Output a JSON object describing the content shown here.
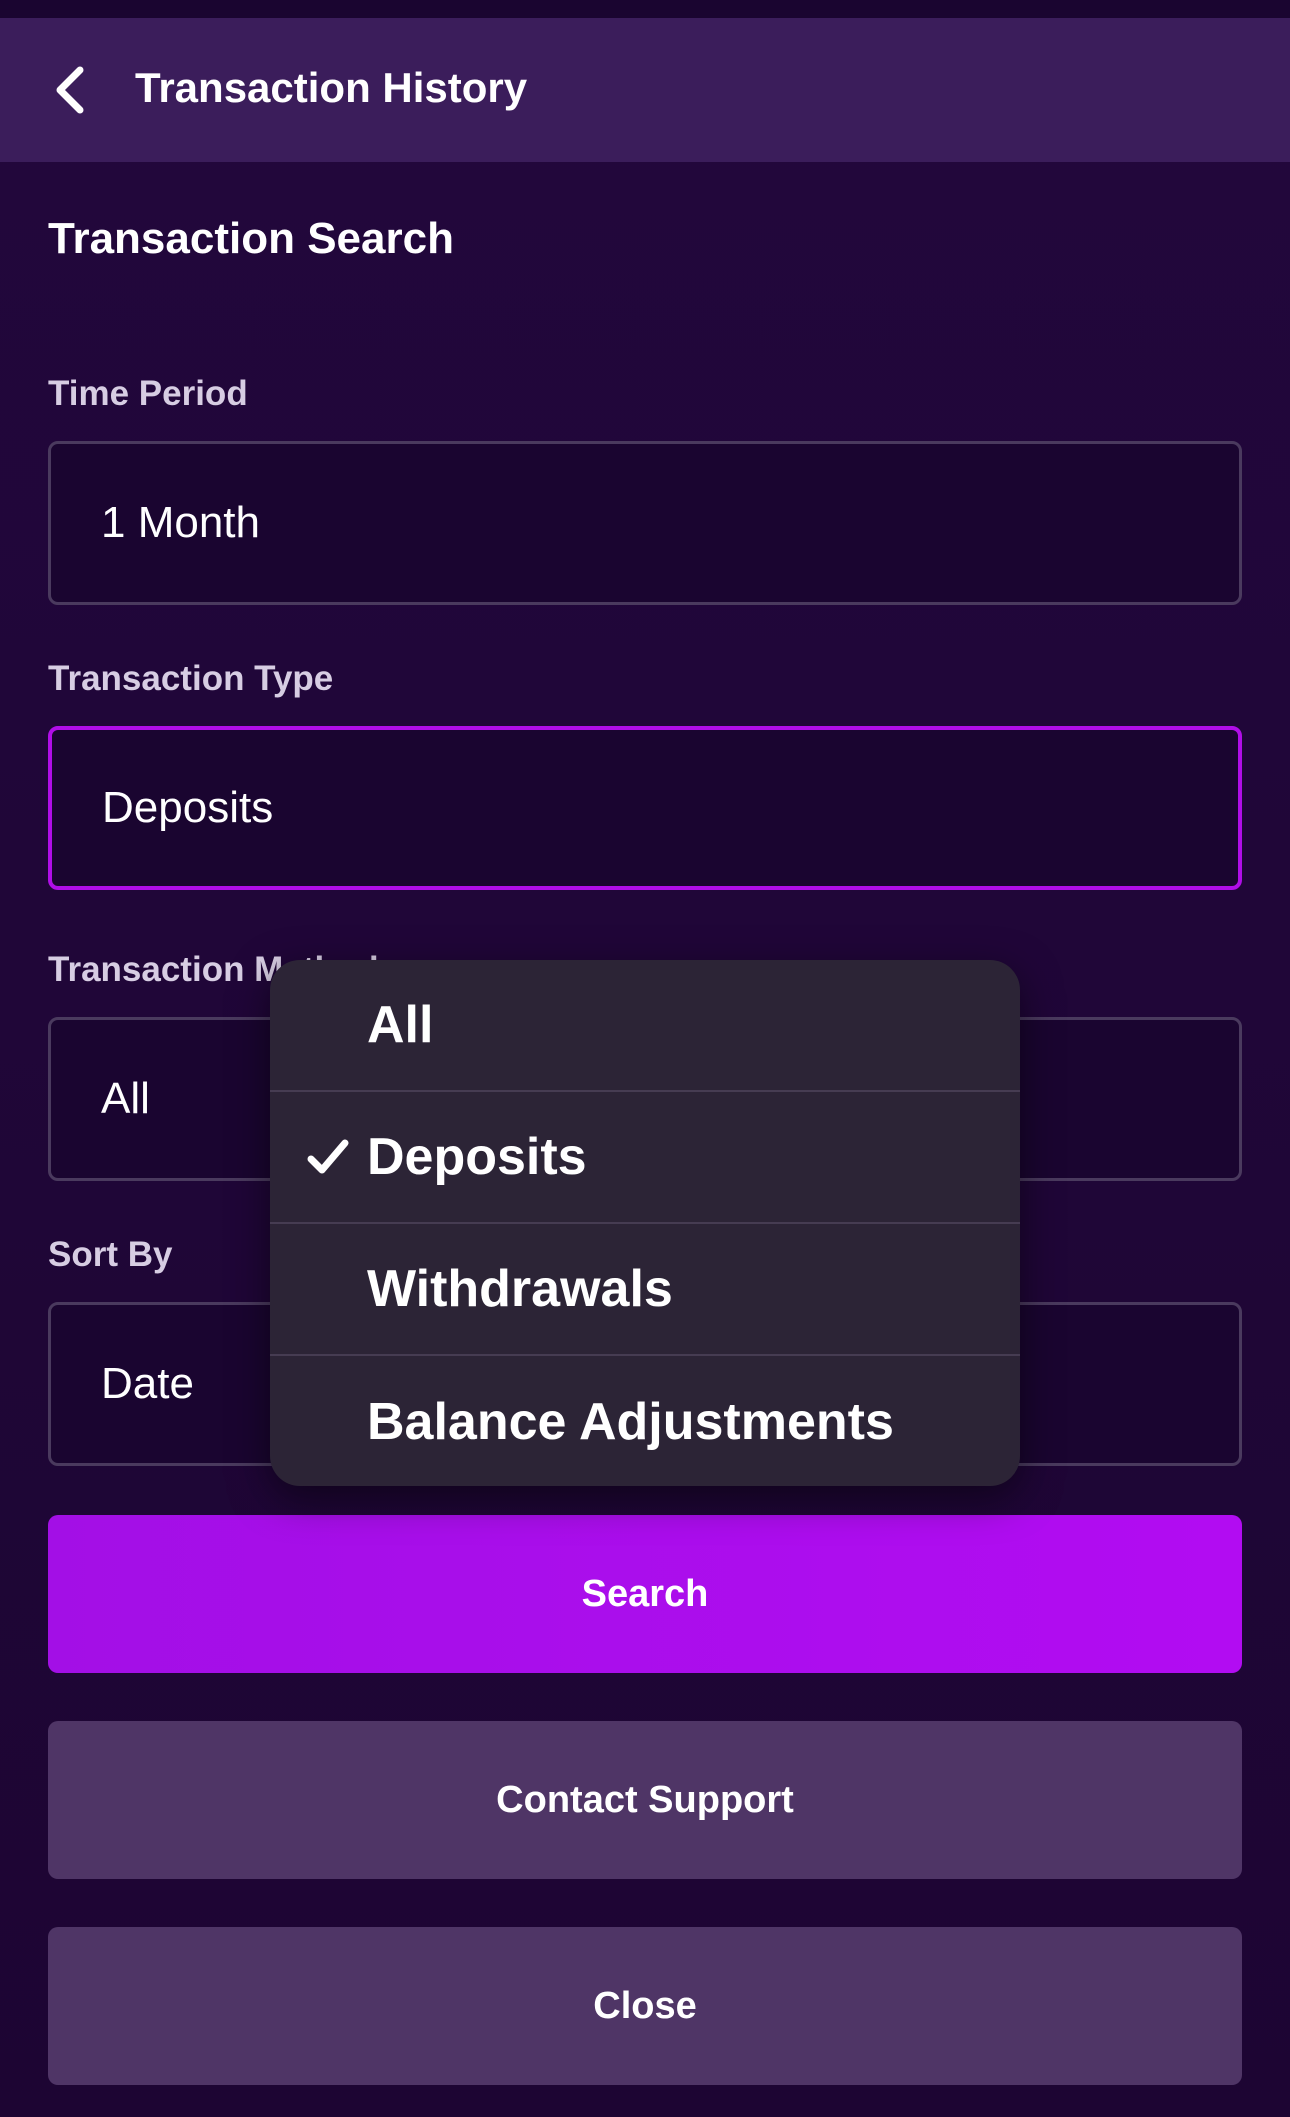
{
  "header": {
    "title": "Transaction History",
    "back_icon": "chevron-left-icon"
  },
  "section": {
    "title": "Transaction Search"
  },
  "fields": {
    "time_period": {
      "label": "Time Period",
      "value": "1 Month"
    },
    "transaction_type": {
      "label": "Transaction Type",
      "value": "Deposits"
    },
    "transaction_method": {
      "label": "Transaction Method",
      "value": "All"
    },
    "sort_by": {
      "label": "Sort By",
      "value": "Date"
    }
  },
  "dropdown": {
    "options": [
      {
        "label": "All",
        "selected": false
      },
      {
        "label": "Deposits",
        "selected": true
      },
      {
        "label": "Withdrawals",
        "selected": false
      },
      {
        "label": "Balance Adjustments",
        "selected": false
      }
    ],
    "check_icon": "checkmark-icon"
  },
  "buttons": {
    "search": "Search",
    "contact_support": "Contact Support",
    "close": "Close"
  },
  "colors": {
    "background": "#1e0635",
    "header": "#3b1d5b",
    "accent": "#b20cf2",
    "secondary_button": "#4f3566",
    "dropdown_bg": "#2c2436"
  }
}
